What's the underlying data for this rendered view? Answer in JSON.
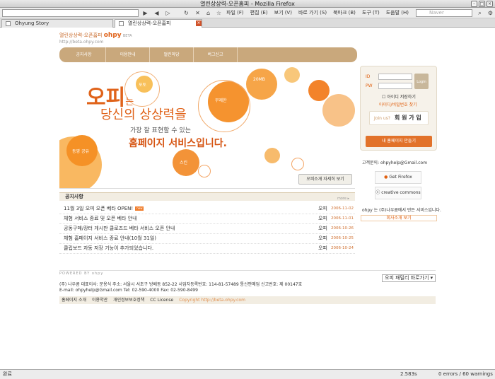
{
  "window": {
    "title": "열린상상력-오픈홈피 - Mozilla Firefox"
  },
  "menu": {
    "items": [
      "파일 (F)",
      "편집 (E)",
      "보기 (V)",
      "바로 가기 (S)",
      "북마크 (B)",
      "도구 (T)",
      "도움말 (H)"
    ]
  },
  "search": {
    "placeholder": "Naver"
  },
  "tabs": [
    {
      "label": "Ohyung Story"
    },
    {
      "label": "열린상상력-오픈홈피"
    }
  ],
  "site": {
    "logo_text": "열린상상력-오픈홈피",
    "brand": "ohpy",
    "beta": "BETA",
    "url": "http://beta.ohpy.com"
  },
  "nav": {
    "items": [
      "공지사항",
      "이용안내",
      "멀린마당",
      "버그신고"
    ]
  },
  "hero": {
    "line1a": "오피",
    "line1b": "는",
    "line2": "당신의 상상력을",
    "line3": "가장 잘 표현할 수 있는",
    "line4": "홈페이지 서비스입니다.",
    "circle_labels": [
      "20MB",
      "무제한",
      "포토",
      "동영 공유",
      "스킨"
    ],
    "more": "오피소개 자세히 보기"
  },
  "login": {
    "id_label": "ID",
    "pw_label": "PW",
    "btn": "Login",
    "save_id": "아이디 저장하기",
    "find": "아이디/비밀번호 찾기",
    "join_prefix": "Join us?",
    "join": "회 원 가 입",
    "make": "내 홈페이지 만들기"
  },
  "side": {
    "support": "고객문의: ohpyhelp@Gmail.com",
    "firefox": "Get Firefox",
    "cc": "creative commons",
    "ohpy_note": "ohpy 는 (주)나우콤에서 만든 서비스입니다.",
    "intro": "회사소개 보기"
  },
  "notices": {
    "title": "공지사항",
    "more": "more ▸",
    "items": [
      {
        "title": "11월 3일 오피 오픈 베타 OPEN!",
        "new": "new",
        "by": "오피",
        "date": "2006-11-02"
      },
      {
        "title": "체험 서비스 종료 및 오픈 베타 안내",
        "by": "오피",
        "date": "2006-11-01"
      },
      {
        "title": "공동구매/장터 게시판 클로즈드 베타 서비스 오픈 안내",
        "by": "오피",
        "date": "2006-10-26"
      },
      {
        "title": "체험 홈페이지 서비스 종료 안내(10월 31일)",
        "by": "오피",
        "date": "2006-10-25"
      },
      {
        "title": "클립보드 자동 저장 기능이 추가되었습니다.",
        "by": "오피",
        "date": "2006-10-24"
      }
    ]
  },
  "footer": {
    "powered": "POWERED BY ohpy",
    "family": "오피 패밀리 바로가기",
    "line1": "(주) 나우콤  대표이사: 문용식  주소: 서울시 서초구 방배동 852-22  사업자등록번호: 114-81-57489  통신판매업 신고번호: 제 00147호",
    "line2": "E-mail: ohpyhelp@Gmail.com   Tel: 02-590-4000   Fax: 02-590-8499",
    "links": [
      "홈페이지 소개",
      "이용약관",
      "개인정보보호정책",
      "CC License",
      "Copyright http://beta.ohpy.com"
    ]
  },
  "status": {
    "left": "완료",
    "time": "2.583s",
    "errors": "0 errors / 60 warnings"
  }
}
